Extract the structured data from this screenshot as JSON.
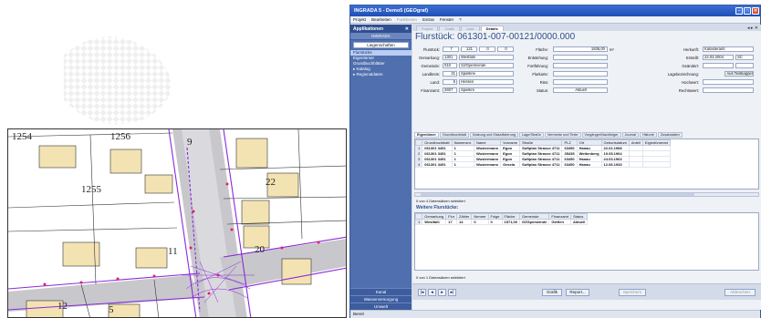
{
  "window": {
    "title": "INGRADA 5 - Demo5 (GEOgraf)",
    "accent": "#2f55b8"
  },
  "menu": [
    "Projekt",
    "Bearbeiten",
    "Funktionen",
    "Extras",
    "Fenster",
    "?"
  ],
  "sidebar": {
    "header": "Applikationen",
    "app": "INGRADA",
    "selector": "Liegenschaften",
    "items": [
      {
        "label": "Flurstücke",
        "active": true
      },
      {
        "label": "Eigentümer",
        "active": false
      },
      {
        "label": "Grundbuchblätter",
        "active": false
      },
      {
        "label": "▸ Katalog",
        "active": false
      },
      {
        "label": "▸ Regionaldaten",
        "active": false
      }
    ],
    "bottom_items": [
      "Kanal",
      "Wasserversorgung",
      "Umwelt"
    ]
  },
  "top_tabs": [
    {
      "label": "Projekt",
      "active": false
    },
    {
      "label": "Grafik",
      "active": false
    },
    {
      "label": "Liste",
      "active": false
    },
    {
      "label": "Details",
      "active": true
    }
  ],
  "nav_arrows": "◂ ▸ ✕",
  "form": {
    "title": "Flurstück:  061301-007-00121/0000.000",
    "labels": {
      "flurstueck": "Flurstück:",
      "gemarkung": "Gemarkung:",
      "gemeinde": "Gemeinde:",
      "landkreis": "Landkreis:",
      "land": "Land:",
      "finanzamt": "Finanzamt:",
      "flaeche": "Fläche:",
      "entstehung": "Entstehung:",
      "fortfuehrung": "Fortführung:",
      "flurkarte": "Flurkarte:",
      "riss": "Riss:",
      "status": "Status:",
      "herkunft": "Herkunft:",
      "erstellt": "Erstellt:",
      "geaendert": "Geändert:",
      "lagebezeichnung": "Lagebezeichnung:",
      "hochwert": "Hochwert:",
      "rechtswert": "Rechtswert:"
    },
    "values": {
      "flurstueck_1": "7",
      "flurstueck_2": "121",
      "flurstueck_3": "0",
      "flurstueck_4": "0",
      "gemarkung_nr": "1301",
      "gemarkung_name": "Westfalli",
      "gemeinde_nr": "010",
      "gemeinde_name": "GZGpemeinde",
      "landkreis_nr": "21",
      "landkreis_name": "Spielkrei",
      "land_nr": "6",
      "land_name": "Hessen",
      "finanzamt_nr": "2607",
      "finanzamt_name": "Spielkre",
      "flaeche": "1836,00",
      "flaeche_unit": "m²",
      "status": "Aktuell",
      "herkunft": "Katasteramt",
      "erstellt": "22.03.2004",
      "erstellt_by": "SC",
      "lage_button": "Aus Textkappel"
    }
  },
  "sub_tabs": [
    {
      "label": "Eigentümer",
      "active": true
    },
    {
      "label": "Grundbuchblatt",
      "active": false
    },
    {
      "label": "Nutzung und Klassifizierung",
      "active": false
    },
    {
      "label": "Lage/Straße",
      "active": false
    },
    {
      "label": "Vermerke und Texte",
      "active": false
    },
    {
      "label": "Vorgänger/Nachfolger",
      "active": false
    },
    {
      "label": "Journal",
      "active": false
    },
    {
      "label": "Historie",
      "active": false
    },
    {
      "label": "Zusatzdaten",
      "active": false
    }
  ],
  "owners_table": {
    "columns": [
      "Grundbuchblatt",
      "Namensnr.",
      "Name",
      "Vorname",
      "Straße",
      "PLZ",
      "Ort",
      "Geburtsdatum",
      "Anteil",
      "Eigentümerart"
    ],
    "rows": [
      [
        "061301 3451",
        "1",
        "Wustermann",
        "Egon",
        "Softplan Strasse 4711",
        "63450",
        "Hanau",
        "22.01.1968",
        "",
        ""
      ],
      [
        "061301 3451",
        "1",
        "Wustermann",
        "Egon",
        "Softplan Strasse 4711",
        "35435",
        "Wettenberg",
        "19.05.1964",
        "",
        ""
      ],
      [
        "061301 3451",
        "1",
        "Wustermann",
        "Egon",
        "Softplan Strasse 4711",
        "63450",
        "Hanau",
        "24.03.1963",
        "",
        ""
      ],
      [
        "061301 3451",
        "1",
        "Wustermann",
        "Gesela",
        "Softplan Strasse 4711",
        "63450",
        "Hanau",
        "12.06.1933",
        "",
        ""
      ]
    ],
    "status": "0 von 4 Datensätzen selektiert"
  },
  "section_title": "Weitere Flurstücke:",
  "parcels_table": {
    "columns": [
      "Gemarkung",
      "Flur",
      "Zähler",
      "Nenner",
      "Folge",
      "Fläche",
      "Gemeinde",
      "Finanzamt",
      "Status"
    ],
    "rows": [
      [
        "Westfalli",
        "17",
        "14",
        "0",
        "0",
        "1571,00",
        "GZGpemeinde",
        "Gieflen",
        "Aktuell"
      ]
    ],
    "status": "0 von 1 Datensätzen selektiert"
  },
  "buttons": {
    "first": "|◂",
    "prev": "◂",
    "next": "▸",
    "last": "▸|",
    "grafik": "Grafik",
    "report": "Report...",
    "speichern": "Speichern",
    "abbrechen": "Abbrechen"
  },
  "statusbar": "Bereit",
  "map": {
    "labels": [
      "1254",
      "1256",
      "1255",
      "9",
      "22",
      "11",
      "20",
      "12",
      "5"
    ]
  }
}
